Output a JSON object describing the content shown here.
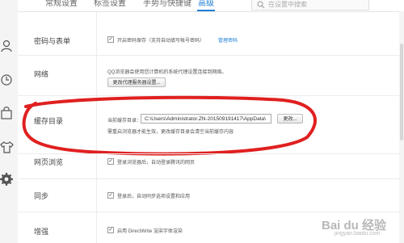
{
  "tabs": [
    {
      "label": "常规设置"
    },
    {
      "label": "标签设置"
    },
    {
      "label": "手势与快捷键"
    },
    {
      "label": "高级"
    }
  ],
  "search": {
    "placeholder": "在设置中搜索"
  },
  "sidebar": {
    "icons": [
      "user-icon",
      "history-icon",
      "bag-icon",
      "shirt-icon",
      "gear-icon"
    ]
  },
  "sections": {
    "password": {
      "label": "密码与表单",
      "checkbox_label": "开启密码保存（支持自动填写帐号密码）",
      "link": "管理密码"
    },
    "network": {
      "label": "网络",
      "desc": "QQ浏览器会使用您计算机的系统代理设置连接到网络。",
      "button": "更改代理服务器设置..."
    },
    "cache": {
      "label": "缓存目录",
      "current_label": "当前缓存目录：",
      "path": "C:\\Users\\Administrator.ZN-201509191417\\AppData\\",
      "button": "更改...",
      "note": "需重启浏览器才能生效，更改缓存目录会清空当前缓存内容"
    },
    "browse": {
      "label": "网页浏览",
      "checkbox_label": "登录浏览器后，自动登录腾讯的网页"
    },
    "sync": {
      "label": "同步",
      "checkbox_label": "登录后，自动同步选项设置和应用"
    },
    "enhance": {
      "label": "增强",
      "checkbox_label": "启用 DirectWrite 渲染字体渲染"
    }
  },
  "watermark": {
    "text": "Bai du 经验",
    "sub": "jingyan.baidu.com"
  },
  "colors": {
    "accent": "#1f7fd6",
    "annotation": "#e02020"
  }
}
